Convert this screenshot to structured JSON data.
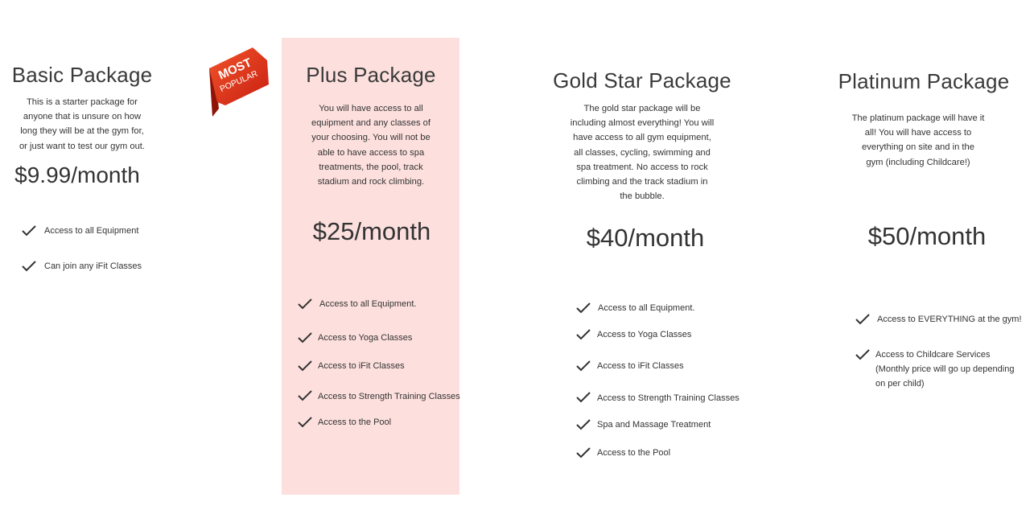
{
  "badge": {
    "line1": "MOST",
    "line2": "POPULAR"
  },
  "packages": [
    {
      "title": "Basic Package",
      "description": [
        "This is a starter package for",
        "anyone that is unsure on how",
        "long they will be at the gym for,",
        "or just want to test our gym out."
      ],
      "price": "$9.99/month",
      "features": [
        "Access to all Equipment",
        "Can join any iFit Classes"
      ]
    },
    {
      "title": "Plus Package",
      "description": [
        "You will have access to all",
        "equipment and any classes of",
        "your choosing. You will not be",
        "able to have access to spa",
        "treatments, the pool, track",
        "stadium and rock climbing."
      ],
      "price": "$25/month",
      "features": [
        "Access to all Equipment.",
        "Access to Yoga Classes",
        "Access to iFit Classes",
        "Access to Strength Training Classes",
        "Access to the Pool"
      ]
    },
    {
      "title": "Gold Star Package",
      "description": [
        "The gold star package will be",
        "including almost everything! You will",
        "have access to all gym equipment,",
        "all classes, cycling, swimming and",
        "spa treatment. No access to rock",
        "climbing and the track stadium in",
        "the bubble."
      ],
      "price": "$40/month",
      "features": [
        "Access to all Equipment.",
        "Access to Yoga Classes",
        "Access to iFit Classes",
        "Access to Strength Training Classes",
        "Spa and Massage Treatment",
        "Access to the Pool"
      ]
    },
    {
      "title": "Platinum Package",
      "description": [
        "The platinum package will have it",
        "all! You will have access to",
        "everything on site and in the",
        "gym (including Childcare!)"
      ],
      "price": "$50/month",
      "features": [
        "Access to EVERYTHING at the gym!",
        "Access to Childcare Services",
        "(Monthly price will go up depending",
        "on per child)"
      ]
    }
  ],
  "colors": {
    "highlight": "#fde0de",
    "badge": "#e0341c",
    "text": "#333333"
  }
}
